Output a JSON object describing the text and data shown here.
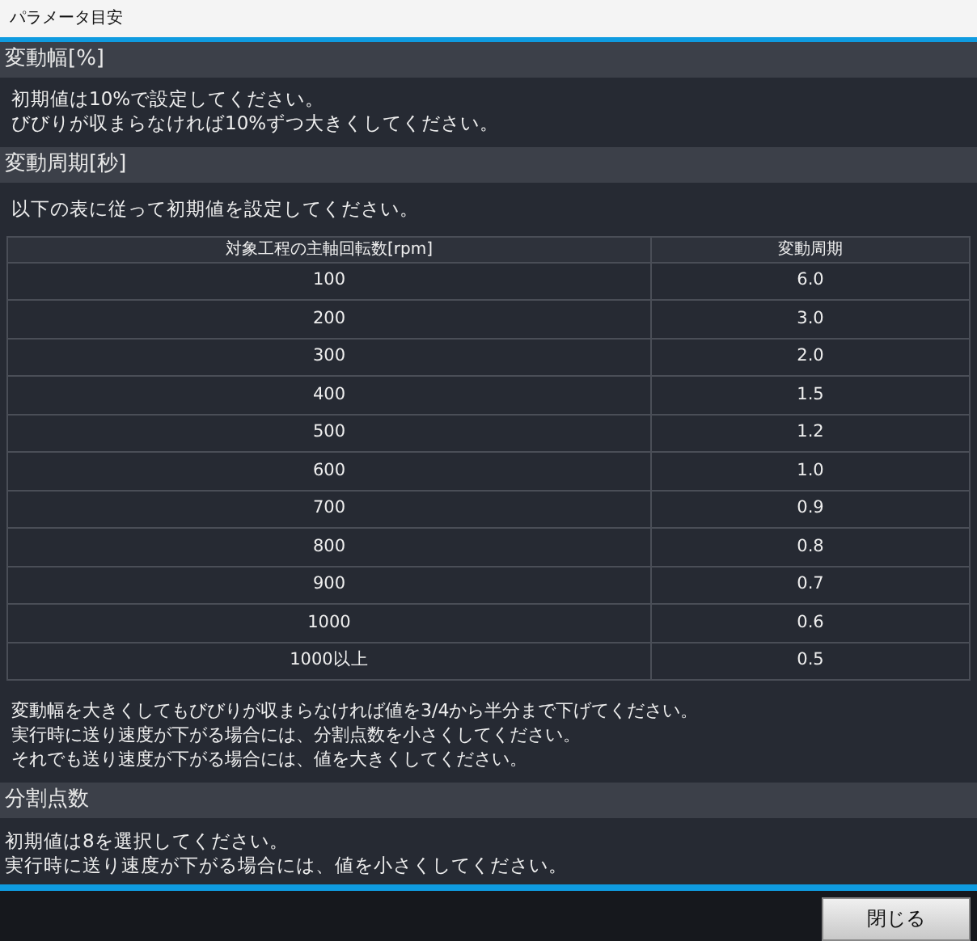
{
  "window": {
    "title": "パラメータ目安"
  },
  "amplitude": {
    "heading": "変動幅[%]",
    "lines": [
      "初期値は10%で設定してください。",
      "びびりが収まらなければ10%ずつ大きくしてください。"
    ]
  },
  "period": {
    "heading": "変動周期[秒]",
    "intro": "以下の表に従って初期値を設定してください。",
    "table": {
      "columns": [
        "対象工程の主軸回転数[rpm]",
        "変動周期"
      ],
      "rows": [
        [
          "100",
          "6.0"
        ],
        [
          "200",
          "3.0"
        ],
        [
          "300",
          "2.0"
        ],
        [
          "400",
          "1.5"
        ],
        [
          "500",
          "1.2"
        ],
        [
          "600",
          "1.0"
        ],
        [
          "700",
          "0.9"
        ],
        [
          "800",
          "0.8"
        ],
        [
          "900",
          "0.7"
        ],
        [
          "1000",
          "0.6"
        ],
        [
          "1000以上",
          "0.5"
        ]
      ]
    },
    "notes": [
      "変動幅を大きくしてもびびりが収まらなければ値を3/4から半分まで下げてください。",
      "実行時に送り速度が下がる場合には、分割点数を小さくしてください。",
      "それでも送り速度が下がる場合には、値を大きくしてください。"
    ]
  },
  "divisions": {
    "heading": "分割点数",
    "lines": [
      "初期値は8を選択してください。",
      "実行時に送り速度が下がる場合には、値を小さくしてください。"
    ]
  },
  "buttons": [
    "閉じる"
  ]
}
